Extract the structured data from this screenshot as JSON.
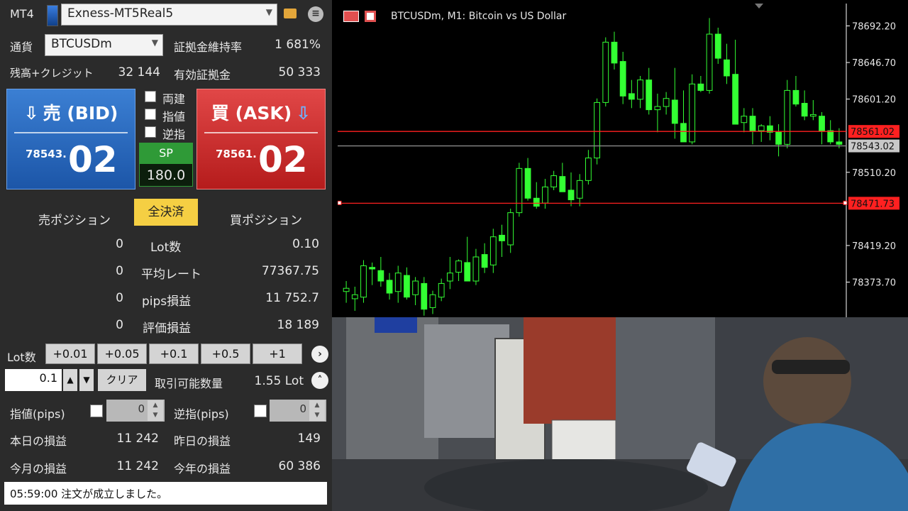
{
  "panel": {
    "logo": "MT4",
    "server": "Exness-MT5Real5",
    "currency_label": "通貨",
    "symbol": "BTCUSDm",
    "margin_level_label": "証拠金維持率",
    "margin_level": "1 681%",
    "balance_label": "残高+クレジット",
    "balance": "32 144",
    "equity_label": "有効証拠金",
    "equity": "50 333",
    "bid": {
      "title": "売 (BID)",
      "small": "78543.",
      "big": "02"
    },
    "ask": {
      "title": "買 (ASK)",
      "small": "78561.",
      "big": "02"
    },
    "checkboxes": [
      "両建",
      "指値",
      "逆指"
    ],
    "spread_label": "SP",
    "spread": "180.0",
    "sell_position_label": "売ポジション",
    "close_all": "全決済",
    "buy_position_label": "買ポジション",
    "position_rows": [
      {
        "sell": "0",
        "label": "Lot数",
        "buy": "0.10"
      },
      {
        "sell": "0",
        "label": "平均レート",
        "buy": "77367.75"
      },
      {
        "sell": "0",
        "label": "pips損益",
        "buy": "11 752.7"
      },
      {
        "sell": "0",
        "label": "評価損益",
        "buy": "18 189"
      }
    ],
    "lot_label": "Lot数",
    "lot_steps": [
      "+0.01",
      "+0.05",
      "+0.1",
      "+0.5",
      "+1"
    ],
    "lot_value": "0.1",
    "clear": "クリア",
    "tradable_label": "取引可能数量",
    "tradable": "1.55 Lot",
    "limit_label": "指値(pips)",
    "limit_value": "0",
    "stop_label": "逆指(pips)",
    "stop_value": "0",
    "today_pl_label": "本日の損益",
    "today_pl": "11 242",
    "yesterday_pl_label": "昨日の損益",
    "yesterday_pl": "149",
    "month_pl_label": "今月の損益",
    "month_pl": "11 242",
    "year_pl_label": "今年の損益",
    "year_pl": "60 386",
    "status": "05:59:00 注文が成立しました。"
  },
  "chart_title": "BTCUSDm, M1:  Bitcoin vs US Dollar",
  "chart_data": {
    "type": "candlestick",
    "ylim": [
      78330,
      78720
    ],
    "y_ticks": [
      "78692.20",
      "78646.70",
      "78601.20",
      "78510.20",
      "78419.20",
      "78373.70"
    ],
    "ask_line": "78561.02",
    "bid_line": "78543.02",
    "position_line": "78471.73",
    "colors": {
      "up": "#000000",
      "outline": "#33ff33",
      "ask": "#ff2020",
      "bid": "#8a8a8a"
    },
    "candles": [
      [
        78362,
        78375,
        78348,
        78366
      ],
      [
        78353,
        78368,
        78338,
        78358
      ],
      [
        78355,
        78401,
        78348,
        78394
      ],
      [
        78392,
        78398,
        78370,
        78390
      ],
      [
        78388,
        78405,
        78368,
        78375
      ],
      [
        78376,
        78385,
        78352,
        78360
      ],
      [
        78362,
        78394,
        78348,
        78385
      ],
      [
        78382,
        78392,
        78352,
        78355
      ],
      [
        78358,
        78380,
        78345,
        78375
      ],
      [
        78372,
        78380,
        78332,
        78340
      ],
      [
        78342,
        78363,
        78334,
        78358
      ],
      [
        78355,
        78378,
        78350,
        78372
      ],
      [
        78375,
        78405,
        78365,
        78385
      ],
      [
        78386,
        78402,
        78375,
        78400
      ],
      [
        78398,
        78430,
        78385,
        78375
      ],
      [
        78375,
        78415,
        78370,
        78405
      ],
      [
        78408,
        78422,
        78385,
        78392
      ],
      [
        78395,
        78440,
        78385,
        78430
      ],
      [
        78432,
        78445,
        78405,
        78425
      ],
      [
        78420,
        78465,
        78410,
        78460
      ],
      [
        78460,
        78522,
        78455,
        78515
      ],
      [
        78515,
        78528,
        78475,
        78478
      ],
      [
        78478,
        78498,
        78465,
        78468
      ],
      [
        78472,
        78502,
        78465,
        78492
      ],
      [
        78492,
        78512,
        78488,
        78506
      ],
      [
        78505,
        78522,
        78495,
        78486
      ],
      [
        78488,
        78510,
        78468,
        78476
      ],
      [
        78478,
        78508,
        78468,
        78500
      ],
      [
        78500,
        78538,
        78495,
        78528
      ],
      [
        78528,
        78602,
        78520,
        78597
      ],
      [
        78597,
        78678,
        78592,
        78672
      ],
      [
        78672,
        78685,
        78638,
        78646
      ],
      [
        78648,
        78660,
        78595,
        78605
      ],
      [
        78608,
        78625,
        78590,
        78601
      ],
      [
        78601,
        78630,
        78590,
        78625
      ],
      [
        78625,
        78640,
        78582,
        78588
      ],
      [
        78588,
        78608,
        78560,
        78592
      ],
      [
        78592,
        78610,
        78582,
        78602
      ],
      [
        78600,
        78640,
        78552,
        78571
      ],
      [
        78571,
        78612,
        78548,
        78548
      ],
      [
        78548,
        78632,
        78545,
        78620
      ],
      [
        78620,
        78630,
        78610,
        78612
      ],
      [
        78612,
        78702,
        78608,
        78682
      ],
      [
        78682,
        78690,
        78645,
        78652
      ],
      [
        78650,
        78670,
        78620,
        78630
      ],
      [
        78632,
        78675,
        78570,
        78570
      ],
      [
        78572,
        78590,
        78560,
        78580
      ],
      [
        78580,
        78590,
        78545,
        78562
      ],
      [
        78562,
        78570,
        78548,
        78568
      ],
      [
        78568,
        78580,
        78550,
        78560
      ],
      [
        78560,
        78570,
        78530,
        78545
      ],
      [
        78545,
        78625,
        78540,
        78612
      ],
      [
        78612,
        78630,
        78592,
        78595
      ],
      [
        78596,
        78612,
        78575,
        78580
      ],
      [
        78580,
        78600,
        78575,
        78582
      ],
      [
        78580,
        78585,
        78545,
        78562
      ],
      [
        78562,
        78575,
        78545,
        78548
      ],
      [
        78548,
        78565,
        78540,
        78545
      ]
    ]
  }
}
